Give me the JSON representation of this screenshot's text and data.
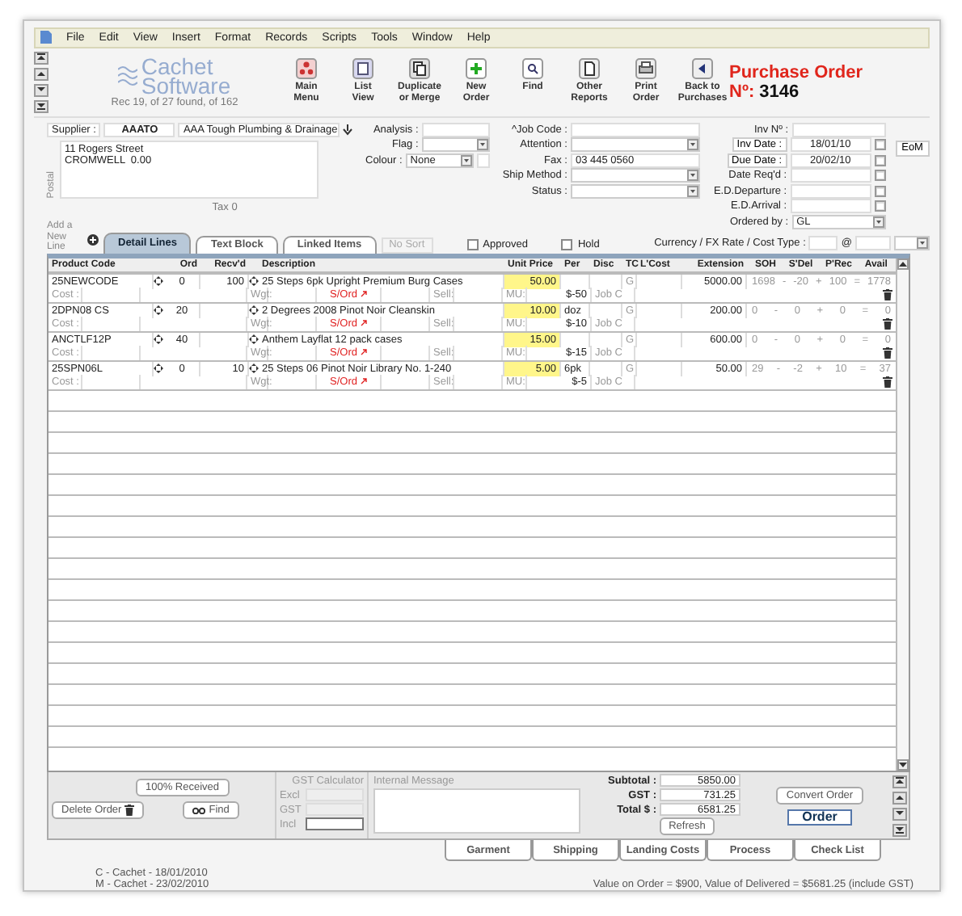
{
  "menu": [
    "File",
    "Edit",
    "View",
    "Insert",
    "Format",
    "Records",
    "Scripts",
    "Tools",
    "Window",
    "Help"
  ],
  "logo": {
    "top": "Cachet",
    "bottom": "Software"
  },
  "record_info": "Rec 19, of 27 found, of 162",
  "toolbar": [
    {
      "lines": [
        "Main",
        "Menu"
      ]
    },
    {
      "lines": [
        "List",
        "View"
      ]
    },
    {
      "lines": [
        "Duplicate",
        "or Merge"
      ]
    },
    {
      "lines": [
        "New",
        "Order"
      ]
    },
    {
      "lines": [
        "Find"
      ]
    },
    {
      "lines": [
        "Other",
        "Reports"
      ]
    },
    {
      "lines": [
        "Print",
        "Order"
      ]
    },
    {
      "lines": [
        "Back to",
        "Purchases"
      ]
    }
  ],
  "title": {
    "text": "Purchase Order",
    "number_label": "Nº:",
    "number": "3146"
  },
  "supplier": {
    "label": "Supplier :",
    "code": "AAATO",
    "name": "AAA Tough Plumbing & Drainage",
    "address": [
      "11 Rogers Street",
      "CROMWELL  0.00"
    ],
    "side_label": "Postal",
    "tax": "Tax 0"
  },
  "analysis_fields": [
    {
      "label": "Analysis :",
      "kind": "text"
    },
    {
      "label": "Flag :",
      "kind": "select"
    },
    {
      "label": "Colour :",
      "kind": "select",
      "value": "None",
      "swatch": true
    }
  ],
  "contact_fields": [
    {
      "label": "^Job Code :",
      "kind": "text"
    },
    {
      "label": "Attention :",
      "kind": "select"
    },
    {
      "label": "Fax :",
      "kind": "text",
      "value": "03 445 0560"
    },
    {
      "label": "Ship Method :",
      "kind": "select"
    },
    {
      "label": "Status :",
      "kind": "select"
    }
  ],
  "date_fields": [
    {
      "label": "Inv Nº :",
      "kind": "text"
    },
    {
      "label": "Inv Date :",
      "kind": "date",
      "value": "18/01/10",
      "label_button": true
    },
    {
      "label": "Due Date :",
      "kind": "date",
      "value": "20/02/10",
      "label_button": true
    },
    {
      "label": "Date Req'd :",
      "kind": "date"
    },
    {
      "label": "E.D.Departure :",
      "kind": "date"
    },
    {
      "label": "E.D.Arrival :",
      "kind": "date"
    },
    {
      "label": "Ordered by :",
      "kind": "select",
      "value": "GL"
    }
  ],
  "eom_button": "EoM",
  "add_line": "Add a New Line",
  "tabs": [
    {
      "label": "Detail Lines",
      "selected": true
    },
    {
      "label": "Text Block",
      "selected": false
    },
    {
      "label": "Linked Items",
      "selected": false
    }
  ],
  "no_sort": "No Sort",
  "checkboxes": [
    {
      "label": "Approved",
      "checked": false
    },
    {
      "label": "Hold",
      "checked": false
    }
  ],
  "currency": {
    "label": "Currency / FX Rate / Cost Type :",
    "at": "@"
  },
  "table": {
    "columns": [
      "Product Code",
      "Ord",
      "Recv'd",
      "Description",
      "Unit Price",
      "Per",
      "Disc",
      "TC",
      "L'Cost",
      "Extension",
      "SOH",
      "S'Del",
      "P'Rec",
      "Avail"
    ],
    "rows": [
      {
        "code": "25NEWCODE",
        "ord": "0",
        "recd": "100",
        "description": "25 Steps 6pk Upright Premium Burg Cases",
        "unit_price": "50.00",
        "tc": "G",
        "extension": "5000.00",
        "stock": [
          "1698",
          "-",
          "-20",
          "+",
          "100",
          "=",
          "1778"
        ],
        "cost_label": "Cost :",
        "wgt_label": "Wgt:",
        "sord": "S/Ord",
        "sell_label": "Sell:",
        "mu_label": "MU:",
        "disc_amount": "$-50",
        "job": "Job C"
      },
      {
        "code": "2DPN08  CS",
        "ord": "20",
        "description": "2 Degrees 2008 Pinot Noir Cleanskin",
        "unit_price": "10.00",
        "per": "doz",
        "tc": "G",
        "extension": "200.00",
        "stock": [
          "0",
          "-",
          "0",
          "+",
          "0",
          "=",
          "0"
        ],
        "cost_label": "Cost :",
        "wgt_label": "Wgt:",
        "sord": "S/Ord",
        "sell_label": "Sell:",
        "mu_label": "MU:",
        "disc_amount": "$-10",
        "job": "Job C"
      },
      {
        "code": "ANCTLF12P",
        "ord": "40",
        "description": "Anthem Layflat 12 pack cases",
        "unit_price": "15.00",
        "tc": "G",
        "extension": "600.00",
        "stock": [
          "0",
          "-",
          "0",
          "+",
          "0",
          "=",
          "0"
        ],
        "cost_label": "Cost :",
        "wgt_label": "Wgt:",
        "sord": "S/Ord",
        "sell_label": "Sell:",
        "mu_label": "MU:",
        "disc_amount": "$-15",
        "job": "Job C"
      },
      {
        "code": "25SPN06L",
        "ord": "0",
        "recd": "10",
        "description": "25 Steps 06 Pinot Noir Library No. 1-240",
        "unit_price": "5.00",
        "per": "6pk",
        "tc": "G",
        "extension": "50.00",
        "stock": [
          "29",
          "-",
          "-2",
          "+",
          "10",
          "=",
          "37"
        ],
        "cost_label": "Cost :",
        "wgt_label": "Wgt:",
        "sord": "S/Ord",
        "sell_label": "Sell:",
        "mu_label": "MU:",
        "disc_amount": "$-5",
        "job": "Job C"
      }
    ]
  },
  "bottom": {
    "received_button": "100% Received",
    "delete_button": "Delete Order",
    "find_button": "Find",
    "gst_title": "GST Calculator",
    "gst_fields": [
      "Excl",
      "GST",
      "Incl"
    ],
    "message_label": "Internal Message",
    "totals": [
      {
        "label": "Subtotal :",
        "value": "5850.00"
      },
      {
        "label": "GST :",
        "value": "731.25"
      },
      {
        "label": "Total $ :",
        "value": "6581.25"
      }
    ],
    "refresh": "Refresh",
    "convert": "Convert Order",
    "order": "Order"
  },
  "bottom_tabs": [
    "Garment",
    "Shipping",
    "Landing Costs",
    "Process",
    "Check List"
  ],
  "footer": {
    "created": "C - Cachet - 18/01/2010",
    "modified": "M - Cachet - 23/02/2010",
    "summary": "Value on Order = $900, Value of Delivered = $5681.25 (include GST)"
  }
}
